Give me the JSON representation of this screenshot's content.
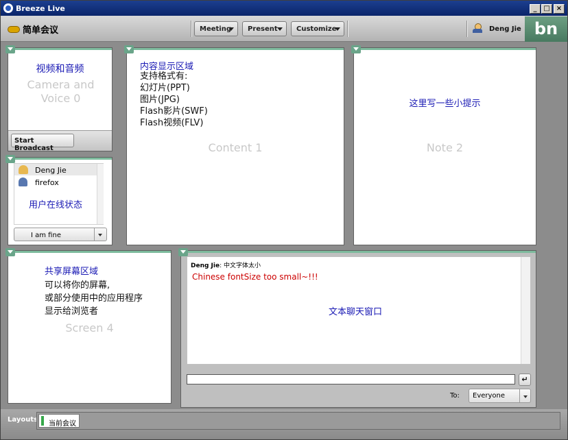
{
  "window": {
    "title": "Breeze Live",
    "minimize": "_",
    "maximize": "□",
    "close": "×"
  },
  "toolbar": {
    "meeting_title": "简单会议",
    "menus": [
      {
        "label": "Meeting"
      },
      {
        "label": "Present"
      },
      {
        "label": "Customize"
      }
    ],
    "user": "Deng Jie",
    "brand": "bn"
  },
  "camera_pod": {
    "note": "视频和音频",
    "name": "Camera and Voice 0",
    "button": "Start Broadcast"
  },
  "attendee_pod": {
    "users": [
      {
        "name": "Deng Jie"
      },
      {
        "name": "firefox"
      }
    ],
    "note": "用户在线状态",
    "status": "I am fine"
  },
  "content_pod": {
    "title": "内容显示区域",
    "lines": [
      "支持格式有:",
      "幻灯片(PPT)",
      "图片(JPG)",
      "Flash影片(SWF)",
      "Flash视频(FLV)"
    ],
    "name": "Content 1"
  },
  "note_pod": {
    "text": "这里写一些小提示",
    "name": "Note 2"
  },
  "screen_pod": {
    "title": "共享屏幕区域",
    "lines": [
      "可以将你的屏幕,",
      "或部分使用中的应用程序",
      "显示给浏览者"
    ],
    "name": "Screen 4"
  },
  "chat_pod": {
    "messages": [
      {
        "sender": "Deng Jie",
        "text": "中文字体太小"
      }
    ],
    "highlight": "Chinese fontSize too small~!!!",
    "note": "文本聊天窗口",
    "input_value": "",
    "send": "↵",
    "to_label": "To:",
    "recipient": "Everyone"
  },
  "layouts": {
    "label": "Layouts",
    "tabs": [
      {
        "label": "当前会议"
      }
    ]
  },
  "colors": {
    "accent": "#6aa58a",
    "title_bar": "#0a246a",
    "note_blue": "#1a1ab4",
    "chat_red": "#cc0000"
  }
}
